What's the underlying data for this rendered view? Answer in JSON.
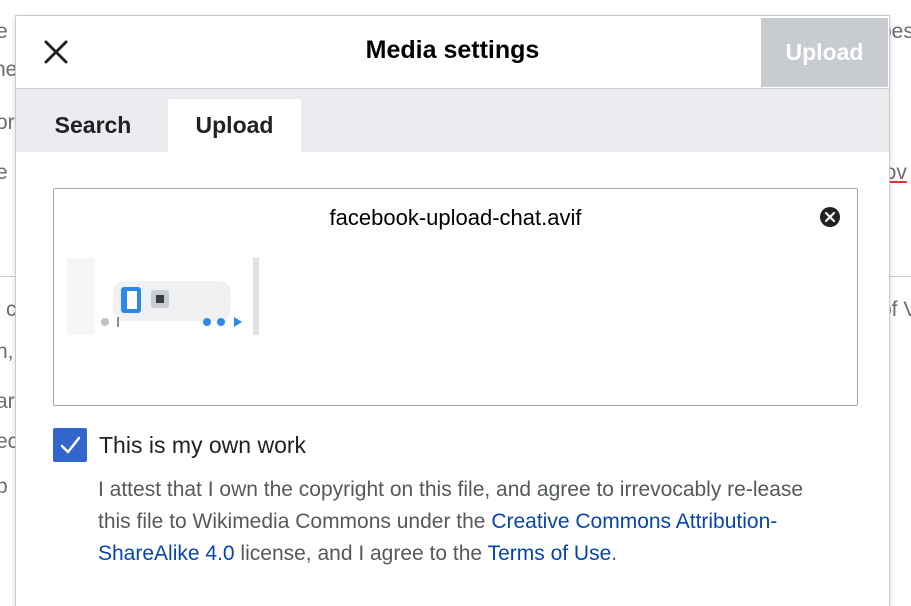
{
  "background": {
    "fragments": [
      "e",
      "ne",
      "or",
      "e",
      "c",
      "n,",
      "ar",
      "ec",
      "p",
      "oes",
      "lov",
      "of V"
    ]
  },
  "dialog": {
    "title": "Media settings",
    "close_icon": "close-icon",
    "upload_button": "Upload",
    "tabs": [
      {
        "label": "Search",
        "active": false
      },
      {
        "label": "Upload",
        "active": true
      }
    ],
    "file": {
      "name": "facebook-upload-chat.avif",
      "remove_icon": "clear-icon"
    },
    "own_work": {
      "checked": true,
      "label": "This is my own work",
      "text_1": "I attest that I own the copyright on this file, and agree to irrevocably re-lease this file to Wikimedia Commons under the ",
      "license_link": "Creative Commons Attribution-ShareAlike 4.0",
      "text_2": " license, and I agree to the ",
      "terms_link": "Terms of Use",
      "text_3": "."
    }
  },
  "colors": {
    "accent": "#3366cc",
    "link": "#0645ad",
    "disabled_button": "#c8ccd1",
    "tab_bar": "#eaecf0"
  }
}
